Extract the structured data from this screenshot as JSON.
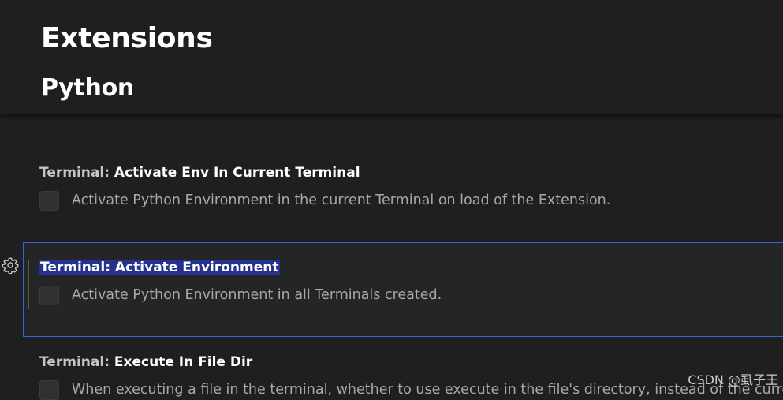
{
  "page": {
    "heading": "Extensions",
    "subheading": "Python"
  },
  "settings": [
    {
      "category": "Terminal: ",
      "name": "Activate Env In Current Terminal",
      "description": "Activate Python Environment in the current Terminal on load of the Extension.",
      "checked": false
    },
    {
      "category": "Terminal: ",
      "name": "Activate Environment",
      "description": "Activate Python Environment in all Terminals created.",
      "checked": false,
      "focused": true,
      "selected_text": true
    },
    {
      "category": "Terminal: ",
      "name": "Execute In File Dir",
      "description": "When executing a file in the terminal, whether to use execute in the file's directory, instead of the current",
      "checked": false
    }
  ],
  "icons": {
    "gear": "gear-icon"
  },
  "colors": {
    "focus_border": "#2f67d6",
    "selection": "#25318e",
    "modified_indicator": "#6b5a3a"
  },
  "watermark": "CSDN @虱子王"
}
